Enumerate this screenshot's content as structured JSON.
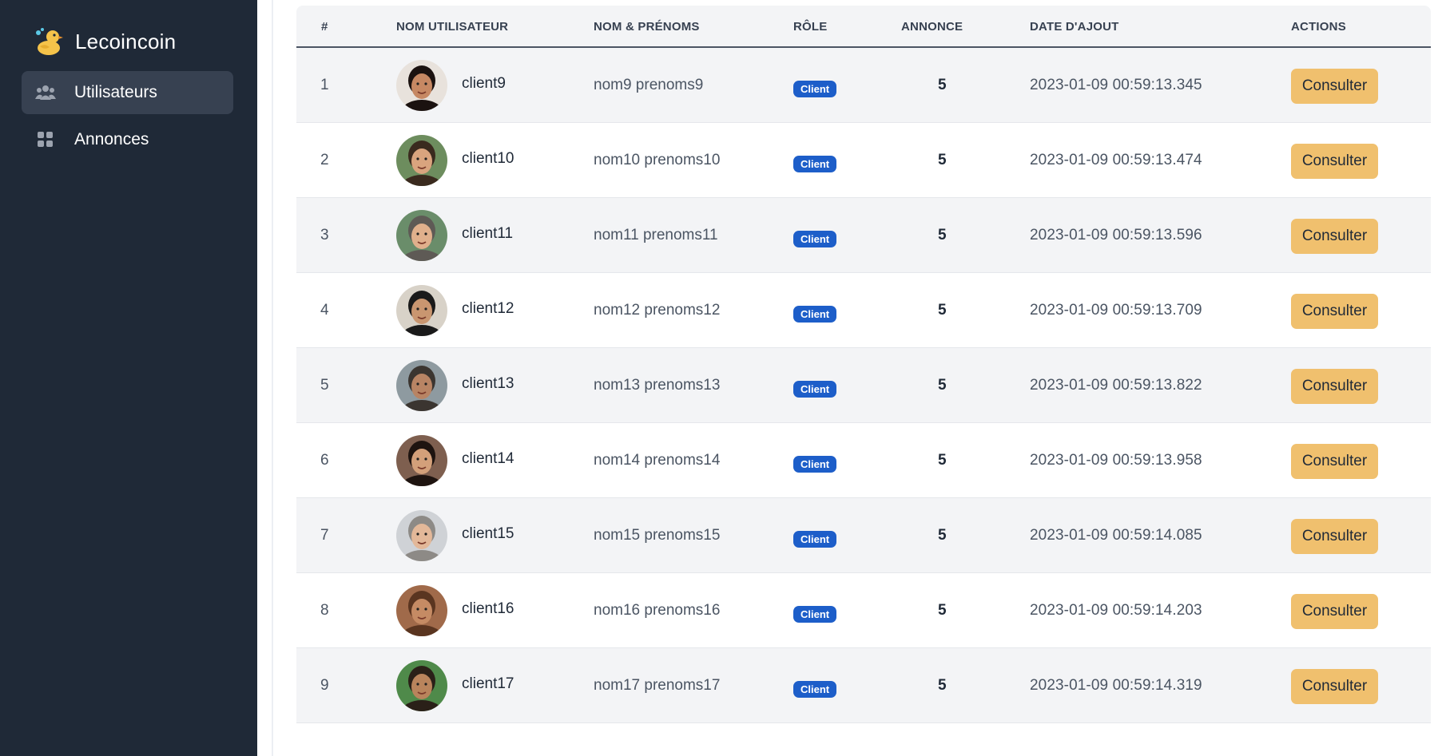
{
  "brand": {
    "name": "Lecoincoin",
    "logo_icon": "duck-icon"
  },
  "sidebar": {
    "items": [
      {
        "label": "Utilisateurs",
        "icon": "users-icon",
        "active": true
      },
      {
        "label": "Annonces",
        "icon": "grid-icon",
        "active": false
      }
    ]
  },
  "table": {
    "headers": [
      "#",
      "Nom utilisateur",
      "Nom & prénoms",
      "Rôle",
      "Annonce",
      "Date d'ajout",
      "Actions"
    ],
    "rows": [
      {
        "index": "1",
        "username": "client9",
        "fullname": "nom9 prenoms9",
        "role": "Client",
        "count": "5",
        "date": "2023-01-09 00:59:13.345",
        "action": "Consulter"
      },
      {
        "index": "2",
        "username": "client10",
        "fullname": "nom10 prenoms10",
        "role": "Client",
        "count": "5",
        "date": "2023-01-09 00:59:13.474",
        "action": "Consulter"
      },
      {
        "index": "3",
        "username": "client11",
        "fullname": "nom11 prenoms11",
        "role": "Client",
        "count": "5",
        "date": "2023-01-09 00:59:13.596",
        "action": "Consulter"
      },
      {
        "index": "4",
        "username": "client12",
        "fullname": "nom12 prenoms12",
        "role": "Client",
        "count": "5",
        "date": "2023-01-09 00:59:13.709",
        "action": "Consulter"
      },
      {
        "index": "5",
        "username": "client13",
        "fullname": "nom13 prenoms13",
        "role": "Client",
        "count": "5",
        "date": "2023-01-09 00:59:13.822",
        "action": "Consulter"
      },
      {
        "index": "6",
        "username": "client14",
        "fullname": "nom14 prenoms14",
        "role": "Client",
        "count": "5",
        "date": "2023-01-09 00:59:13.958",
        "action": "Consulter"
      },
      {
        "index": "7",
        "username": "client15",
        "fullname": "nom15 prenoms15",
        "role": "Client",
        "count": "5",
        "date": "2023-01-09 00:59:14.085",
        "action": "Consulter"
      },
      {
        "index": "8",
        "username": "client16",
        "fullname": "nom16 prenoms16",
        "role": "Client",
        "count": "5",
        "date": "2023-01-09 00:59:14.203",
        "action": "Consulter"
      },
      {
        "index": "9",
        "username": "client17",
        "fullname": "nom17 prenoms17",
        "role": "Client",
        "count": "5",
        "date": "2023-01-09 00:59:14.319",
        "action": "Consulter"
      }
    ]
  },
  "colors": {
    "sidebar_bg": "#1f2937",
    "active_item_bg": "#374151",
    "badge_bg": "#1d5ec9",
    "button_bg": "#f0c06e",
    "row_alt_bg": "#f3f4f6"
  }
}
